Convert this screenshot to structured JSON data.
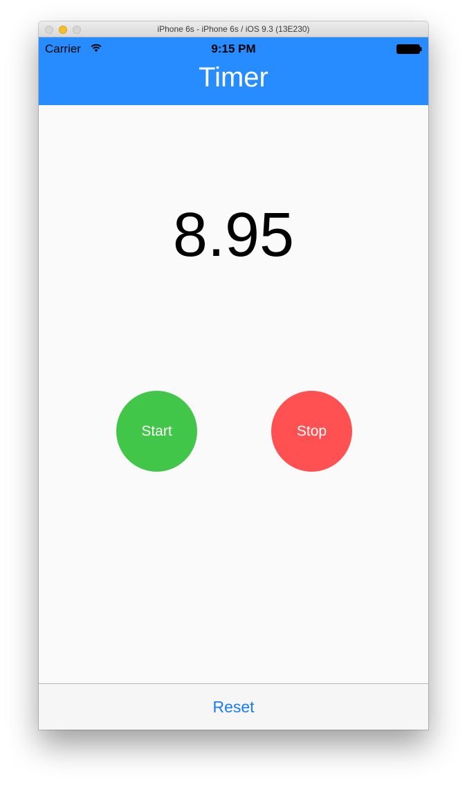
{
  "window": {
    "title": "iPhone 6s - iPhone 6s / iOS 9.3 (13E230)"
  },
  "status_bar": {
    "carrier": "Carrier",
    "time": "9:15 PM",
    "icons": [
      "wifi-icon",
      "battery-icon"
    ]
  },
  "navbar": {
    "title": "Timer"
  },
  "timer": {
    "value": "8.95"
  },
  "buttons": {
    "start_label": "Start",
    "stop_label": "Stop"
  },
  "toolbar": {
    "reset_label": "Reset"
  },
  "colors": {
    "navbar": "#268cff",
    "start": "#42c649",
    "stop": "#ff5052",
    "link": "#1a7cf5"
  }
}
